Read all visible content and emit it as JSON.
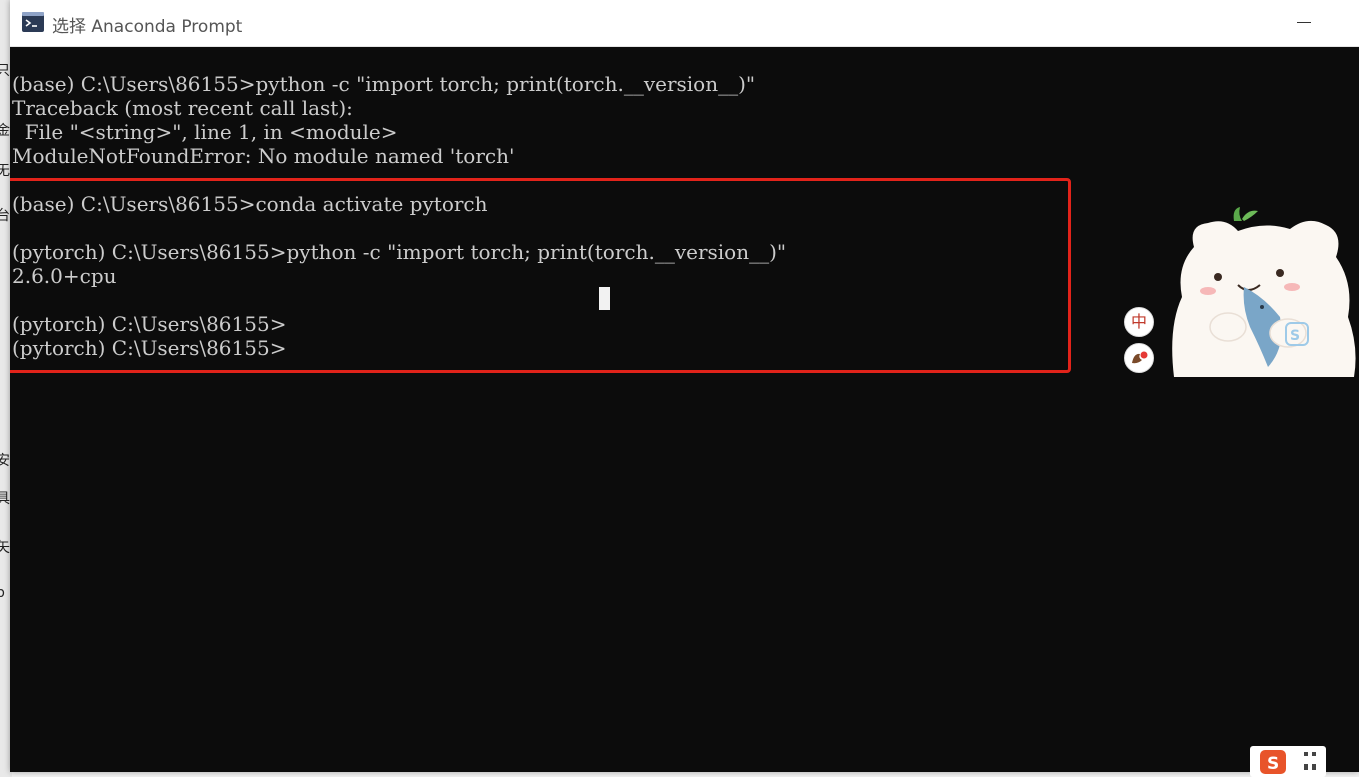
{
  "window": {
    "title": "选择 Anaconda Prompt",
    "icon": "terminal-icon"
  },
  "background_edge_chars": [
    "只",
    "金",
    "旡",
    "台",
    "安",
    "具",
    "矢",
    "p"
  ],
  "terminal": {
    "lines": [
      "(base) C:\\Users\\86155>python -c \"import torch; print(torch.__version__)\"",
      "Traceback (most recent call last):",
      "  File \"<string>\", line 1, in <module>",
      "ModuleNotFoundError: No module named 'torch'",
      "",
      "(base) C:\\Users\\86155>conda activate pytorch",
      "",
      "(pytorch) C:\\Users\\86155>python -c \"import torch; print(torch.__version__)\"",
      "2.6.0+cpu",
      "",
      "(pytorch) C:\\Users\\86155>",
      "(pytorch) C:\\Users\\86155>"
    ],
    "background_color": "#0c0c0c",
    "text_color": "#cccccc"
  },
  "highlight": {
    "color": "#e2231a"
  },
  "ime": {
    "mode_label": "中",
    "tool_icon": "ime-toolbox-icon",
    "mascot_icon": "bear-mascot-icon",
    "taskbar_icon": "sogou-s-icon"
  }
}
